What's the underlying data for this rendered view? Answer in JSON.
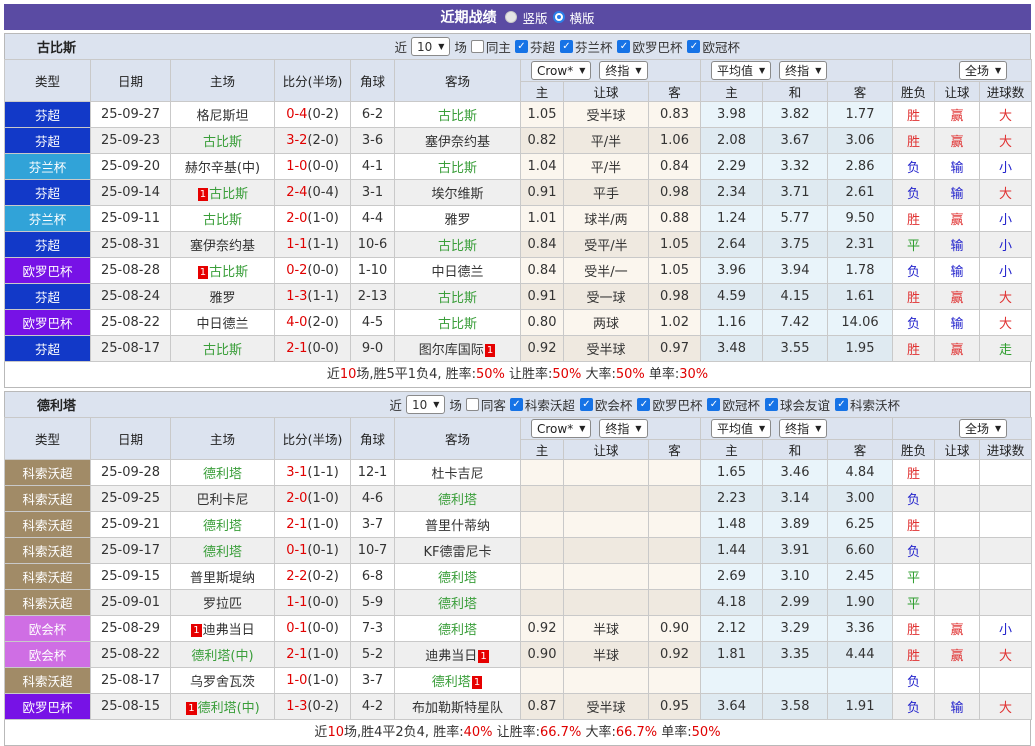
{
  "title_bar": {
    "title": "近期战绩",
    "radios": [
      {
        "label": "竖版",
        "selected": false
      },
      {
        "label": "横版",
        "selected": true
      }
    ]
  },
  "colors": {
    "titlebar_purple": "#5a4ba3",
    "focal_team_green": "#3a9e3a",
    "score_red": "#e00000",
    "red_card_badge": "#e60000",
    "win_red": "#e03232",
    "lose_blue": "#2323cc",
    "draw_green": "#2f9e2f"
  },
  "league_colors": {
    "芬超": "#1239c8",
    "芬兰杯": "#31a3d8",
    "欧罗巴杯": "#7712e6",
    "科索沃超": "#a18b67",
    "欧会杯": "#cf6ee4"
  },
  "table_header": {
    "cols": [
      "类型",
      "日期",
      "主场",
      "比分(半场)",
      "角球",
      "客场"
    ],
    "g1_selects": [
      "Crow*",
      "终指"
    ],
    "g2_selects": [
      "平均值",
      "终指"
    ],
    "g3_selects": [
      "全场"
    ],
    "subcols": [
      "主",
      "让球",
      "客",
      "主",
      "和",
      "客",
      "胜负",
      "让球",
      "进球数"
    ]
  },
  "sections": [
    {
      "team": "古比斯",
      "filter": {
        "near_label": "近",
        "count": "10",
        "games_label": "场",
        "same_label": "同主",
        "same_checked": false,
        "leagues": [
          {
            "label": "芬超",
            "checked": true
          },
          {
            "label": "芬兰杯",
            "checked": true
          },
          {
            "label": "欧罗巴杯",
            "checked": true
          },
          {
            "label": "欧冠杯",
            "checked": true
          }
        ]
      },
      "rows": [
        {
          "league": "芬超",
          "date": "25-09-27",
          "home": {
            "name": "格尼斯坦"
          },
          "score": "0-4",
          "half": "(0-2)",
          "corner": "6-2",
          "away": {
            "name": "古比斯",
            "focal": true
          },
          "let_home": "1.05",
          "let_line": "受半球",
          "let_away": "0.83",
          "avg_home": "3.98",
          "avg_draw": "3.82",
          "avg_away": "1.77",
          "res": "胜",
          "let_res": "赢",
          "goal_res": "大"
        },
        {
          "league": "芬超",
          "date": "25-09-23",
          "home": {
            "name": "古比斯",
            "focal": true
          },
          "score": "3-2",
          "half": "(2-0)",
          "corner": "3-6",
          "away": {
            "name": "塞伊奈约基"
          },
          "let_home": "0.82",
          "let_line": "平/半",
          "let_away": "1.06",
          "avg_home": "2.08",
          "avg_draw": "3.67",
          "avg_away": "3.06",
          "res": "胜",
          "let_res": "赢",
          "goal_res": "大"
        },
        {
          "league": "芬兰杯",
          "date": "25-09-20",
          "home": {
            "name": "赫尔辛基(中)"
          },
          "score": "1-0",
          "half": "(0-0)",
          "corner": "4-1",
          "away": {
            "name": "古比斯",
            "focal": true
          },
          "let_home": "1.04",
          "let_line": "平/半",
          "let_away": "0.84",
          "avg_home": "2.29",
          "avg_draw": "3.32",
          "avg_away": "2.86",
          "res": "负",
          "let_res": "输",
          "goal_res": "小"
        },
        {
          "league": "芬超",
          "date": "25-09-14",
          "home": {
            "name": "古比斯",
            "focal": true,
            "pre": "1"
          },
          "score": "2-4",
          "half": "(0-4)",
          "corner": "3-1",
          "away": {
            "name": "埃尔维斯"
          },
          "let_home": "0.91",
          "let_line": "平手",
          "let_away": "0.98",
          "avg_home": "2.34",
          "avg_draw": "3.71",
          "avg_away": "2.61",
          "res": "负",
          "let_res": "输",
          "goal_res": "大"
        },
        {
          "league": "芬兰杯",
          "date": "25-09-11",
          "home": {
            "name": "古比斯",
            "focal": true
          },
          "score": "2-0",
          "half": "(1-0)",
          "corner": "4-4",
          "away": {
            "name": "雅罗"
          },
          "let_home": "1.01",
          "let_line": "球半/两",
          "let_away": "0.88",
          "avg_home": "1.24",
          "avg_draw": "5.77",
          "avg_away": "9.50",
          "res": "胜",
          "let_res": "赢",
          "goal_res": "小"
        },
        {
          "league": "芬超",
          "date": "25-08-31",
          "home": {
            "name": "塞伊奈约基"
          },
          "score": "1-1",
          "half": "(1-1)",
          "corner": "10-6",
          "away": {
            "name": "古比斯",
            "focal": true
          },
          "let_home": "0.84",
          "let_line": "受平/半",
          "let_away": "1.05",
          "avg_home": "2.64",
          "avg_draw": "3.75",
          "avg_away": "2.31",
          "res": "平",
          "let_res": "输",
          "goal_res": "小"
        },
        {
          "league": "欧罗巴杯",
          "date": "25-08-28",
          "home": {
            "name": "古比斯",
            "focal": true,
            "pre": "1"
          },
          "score": "0-2",
          "half": "(0-0)",
          "corner": "1-10",
          "away": {
            "name": "中日德兰"
          },
          "let_home": "0.84",
          "let_line": "受半/一",
          "let_away": "1.05",
          "avg_home": "3.96",
          "avg_draw": "3.94",
          "avg_away": "1.78",
          "res": "负",
          "let_res": "输",
          "goal_res": "小"
        },
        {
          "league": "芬超",
          "date": "25-08-24",
          "home": {
            "name": "雅罗"
          },
          "score": "1-3",
          "half": "(1-1)",
          "corner": "2-13",
          "away": {
            "name": "古比斯",
            "focal": true
          },
          "let_home": "0.91",
          "let_line": "受一球",
          "let_away": "0.98",
          "avg_home": "4.59",
          "avg_draw": "4.15",
          "avg_away": "1.61",
          "res": "胜",
          "let_res": "赢",
          "goal_res": "大"
        },
        {
          "league": "欧罗巴杯",
          "date": "25-08-22",
          "home": {
            "name": "中日德兰"
          },
          "score": "4-0",
          "half": "(2-0)",
          "corner": "4-5",
          "away": {
            "name": "古比斯",
            "focal": true
          },
          "let_home": "0.80",
          "let_line": "两球",
          "let_away": "1.02",
          "avg_home": "1.16",
          "avg_draw": "7.42",
          "avg_away": "14.06",
          "res": "负",
          "let_res": "输",
          "goal_res": "大"
        },
        {
          "league": "芬超",
          "date": "25-08-17",
          "home": {
            "name": "古比斯",
            "focal": true
          },
          "score": "2-1",
          "half": "(0-0)",
          "corner": "9-0",
          "away": {
            "name": "图尔库国际",
            "post": "1"
          },
          "let_home": "0.92",
          "let_line": "受半球",
          "let_away": "0.97",
          "avg_home": "3.48",
          "avg_draw": "3.55",
          "avg_away": "1.95",
          "res": "胜",
          "let_res": "赢",
          "goal_res": "走"
        }
      ],
      "summary": [
        {
          "t": "近"
        },
        {
          "t": "10",
          "red": true
        },
        {
          "t": "场,胜5平1负4, 胜率:"
        },
        {
          "t": "50%",
          "red": true
        },
        {
          "t": " 让胜率:"
        },
        {
          "t": "50%",
          "red": true
        },
        {
          "t": " 大率:"
        },
        {
          "t": "50%",
          "red": true
        },
        {
          "t": " 单率:"
        },
        {
          "t": "30%",
          "red": true
        }
      ]
    },
    {
      "team": "德利塔",
      "filter": {
        "near_label": "近",
        "count": "10",
        "games_label": "场",
        "same_label": "同客",
        "same_checked": false,
        "leagues": [
          {
            "label": "科索沃超",
            "checked": true
          },
          {
            "label": "欧会杯",
            "checked": true
          },
          {
            "label": "欧罗巴杯",
            "checked": true
          },
          {
            "label": "欧冠杯",
            "checked": true
          },
          {
            "label": "球会友谊",
            "checked": true
          },
          {
            "label": "科索沃杯",
            "checked": true
          }
        ]
      },
      "rows": [
        {
          "league": "科索沃超",
          "date": "25-09-28",
          "home": {
            "name": "德利塔",
            "focal": true
          },
          "score": "3-1",
          "half": "(1-1)",
          "corner": "12-1",
          "away": {
            "name": "杜卡吉尼"
          },
          "avg_home": "1.65",
          "avg_draw": "3.46",
          "avg_away": "4.84",
          "res": "胜"
        },
        {
          "league": "科索沃超",
          "date": "25-09-25",
          "home": {
            "name": "巴利卡尼"
          },
          "score": "2-0",
          "half": "(1-0)",
          "corner": "4-6",
          "away": {
            "name": "德利塔",
            "focal": true
          },
          "avg_home": "2.23",
          "avg_draw": "3.14",
          "avg_away": "3.00",
          "res": "负"
        },
        {
          "league": "科索沃超",
          "date": "25-09-21",
          "home": {
            "name": "德利塔",
            "focal": true
          },
          "score": "2-1",
          "half": "(1-0)",
          "corner": "3-7",
          "away": {
            "name": "普里什蒂纳"
          },
          "avg_home": "1.48",
          "avg_draw": "3.89",
          "avg_away": "6.25",
          "res": "胜"
        },
        {
          "league": "科索沃超",
          "date": "25-09-17",
          "home": {
            "name": "德利塔",
            "focal": true
          },
          "score": "0-1",
          "half": "(0-1)",
          "corner": "10-7",
          "away": {
            "name": "KF德雷尼卡"
          },
          "avg_home": "1.44",
          "avg_draw": "3.91",
          "avg_away": "6.60",
          "res": "负"
        },
        {
          "league": "科索沃超",
          "date": "25-09-15",
          "home": {
            "name": "普里斯堤纳"
          },
          "score": "2-2",
          "half": "(0-2)",
          "corner": "6-8",
          "away": {
            "name": "德利塔",
            "focal": true
          },
          "avg_home": "2.69",
          "avg_draw": "3.10",
          "avg_away": "2.45",
          "res": "平"
        },
        {
          "league": "科索沃超",
          "date": "25-09-01",
          "home": {
            "name": "罗拉匹"
          },
          "score": "1-1",
          "half": "(0-0)",
          "corner": "5-9",
          "away": {
            "name": "德利塔",
            "focal": true
          },
          "avg_home": "4.18",
          "avg_draw": "2.99",
          "avg_away": "1.90",
          "res": "平"
        },
        {
          "league": "欧会杯",
          "date": "25-08-29",
          "home": {
            "name": "迪弗当日",
            "pre": "1"
          },
          "score": "0-1",
          "half": "(0-0)",
          "corner": "7-3",
          "away": {
            "name": "德利塔",
            "focal": true
          },
          "let_home": "0.92",
          "let_line": "半球",
          "let_away": "0.90",
          "avg_home": "2.12",
          "avg_draw": "3.29",
          "avg_away": "3.36",
          "res": "胜",
          "let_res": "赢",
          "goal_res": "小"
        },
        {
          "league": "欧会杯",
          "date": "25-08-22",
          "home": {
            "name": "德利塔(中)",
            "focal": true
          },
          "score": "2-1",
          "half": "(1-0)",
          "corner": "5-2",
          "away": {
            "name": "迪弗当日",
            "post": "1"
          },
          "let_home": "0.90",
          "let_line": "半球",
          "let_away": "0.92",
          "avg_home": "1.81",
          "avg_draw": "3.35",
          "avg_away": "4.44",
          "res": "胜",
          "let_res": "赢",
          "goal_res": "大"
        },
        {
          "league": "科索沃超",
          "date": "25-08-17",
          "home": {
            "name": "乌罗舍瓦茨"
          },
          "score": "1-0",
          "half": "(1-0)",
          "corner": "3-7",
          "away": {
            "name": "德利塔",
            "focal": true,
            "post": "1"
          },
          "res": "负"
        },
        {
          "league": "欧罗巴杯",
          "date": "25-08-15",
          "home": {
            "name": "德利塔(中)",
            "focal": true,
            "pre": "1"
          },
          "score": "1-3",
          "half": "(0-2)",
          "corner": "4-2",
          "away": {
            "name": "布加勒斯特星队"
          },
          "let_home": "0.87",
          "let_line": "受半球",
          "let_away": "0.95",
          "avg_home": "3.64",
          "avg_draw": "3.58",
          "avg_away": "1.91",
          "res": "负",
          "let_res": "输",
          "goal_res": "大"
        }
      ],
      "summary": [
        {
          "t": "近"
        },
        {
          "t": "10",
          "red": true
        },
        {
          "t": "场,胜4平2负4, 胜率:"
        },
        {
          "t": "40%",
          "red": true
        },
        {
          "t": " 让胜率:"
        },
        {
          "t": "66.7%",
          "red": true
        },
        {
          "t": " 大率:"
        },
        {
          "t": "66.7%",
          "red": true
        },
        {
          "t": " 单率:"
        },
        {
          "t": "50%",
          "red": true
        }
      ]
    }
  ]
}
